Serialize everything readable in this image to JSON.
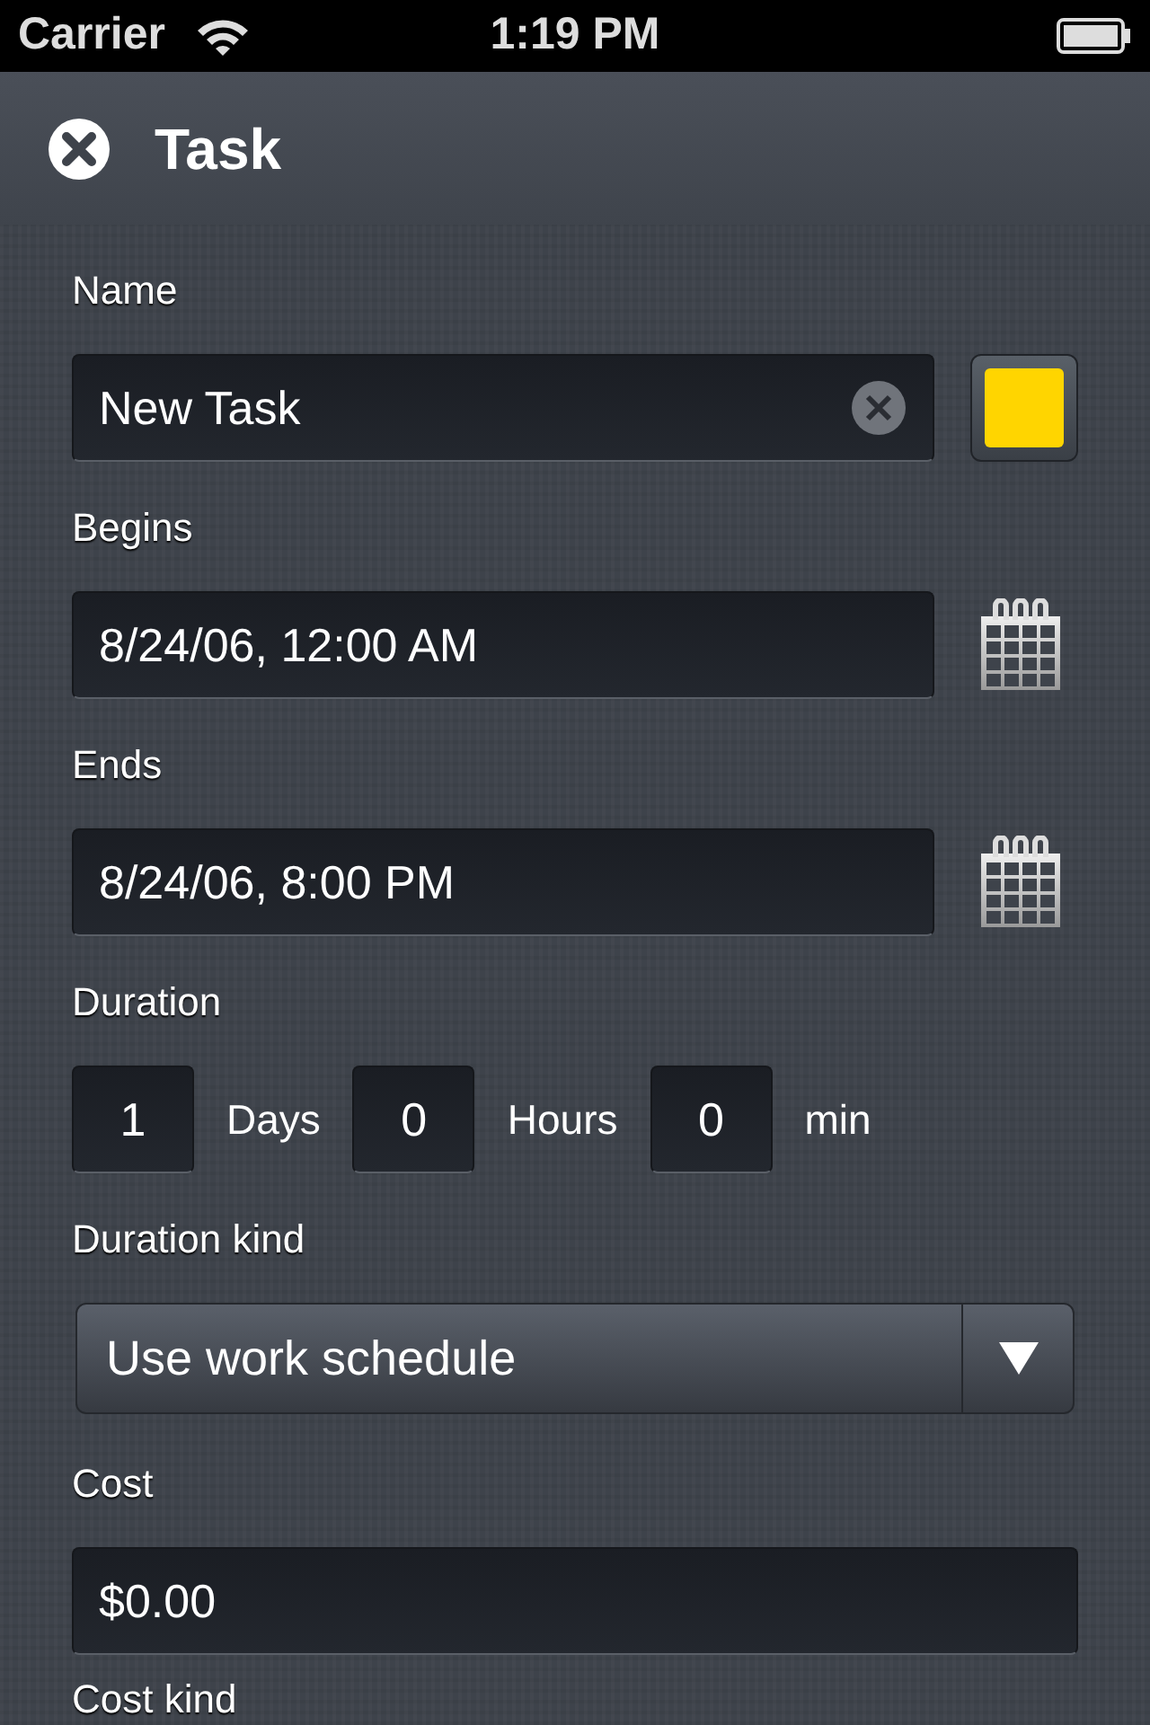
{
  "status_bar": {
    "carrier": "Carrier",
    "time": "1:19 PM"
  },
  "header": {
    "title": "Task"
  },
  "sections": [
    {
      "kind": "text",
      "label": "Name",
      "value": "New Task",
      "color": "#ffd500"
    },
    {
      "kind": "date",
      "label": "Begins",
      "value": "8/24/06, 12:00 AM"
    },
    {
      "kind": "date",
      "label": "Ends",
      "value": "8/24/06, 8:00 PM"
    },
    {
      "kind": "duration",
      "label": "Duration",
      "parts": [
        {
          "value": "1",
          "unit": "Days"
        },
        {
          "value": "0",
          "unit": "Hours"
        },
        {
          "value": "0",
          "unit": "min"
        }
      ]
    },
    {
      "kind": "select",
      "label": "Duration kind",
      "value": "Use work schedule"
    },
    {
      "kind": "money",
      "label": "Cost",
      "value": "$0.00"
    },
    {
      "kind": "label",
      "label": "Cost kind"
    }
  ]
}
